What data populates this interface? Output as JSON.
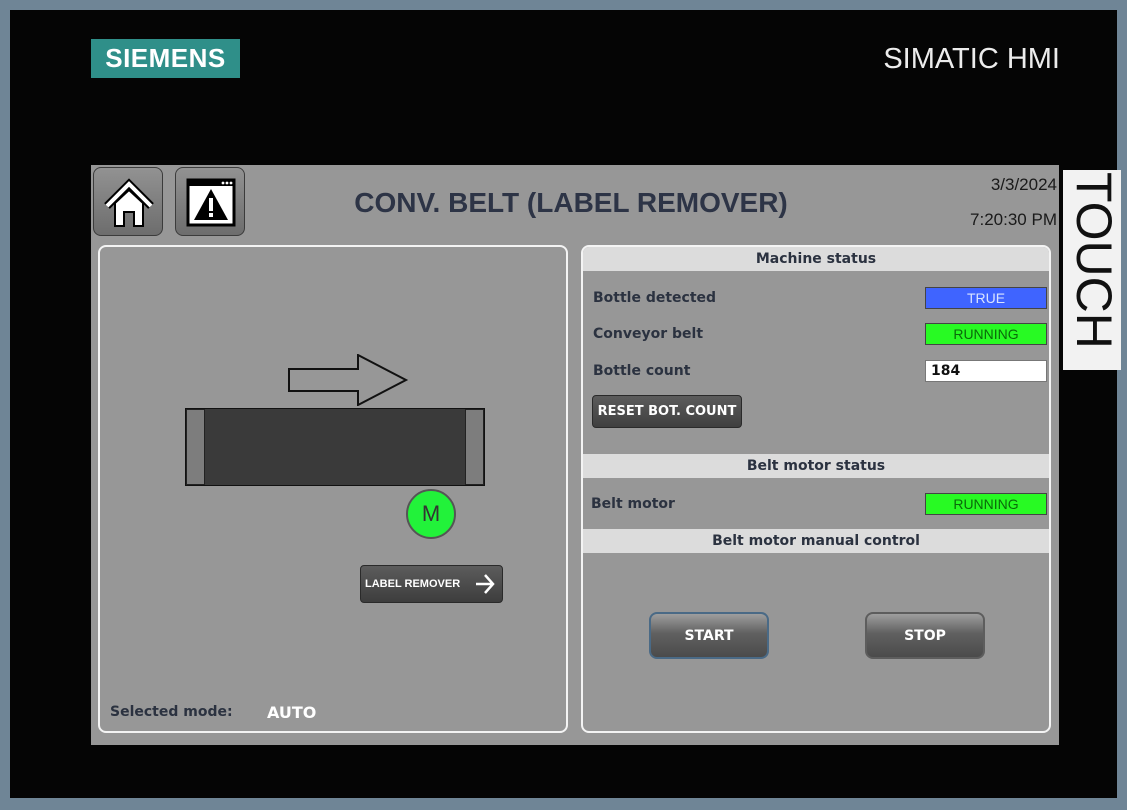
{
  "brand": "SIEMENS",
  "device": "SIMATIC HMI",
  "side_label": "TOUCH",
  "header": {
    "title": "CONV. BELT (LABEL REMOVER)",
    "date": "3/3/2024",
    "time": "7:20:30 PM"
  },
  "left_panel": {
    "motor_label": "M",
    "nav_button": "LABEL REMOVER",
    "selected_mode_label": "Selected mode:",
    "selected_mode_value": "AUTO"
  },
  "machine_status": {
    "title": "Machine status",
    "bottle_detected_label": "Bottle detected",
    "bottle_detected_value": "TRUE",
    "conveyor_belt_label": "Conveyor belt",
    "conveyor_belt_value": "RUNNING",
    "bottle_count_label": "Bottle count",
    "bottle_count_value": "184",
    "reset_button": "RESET BOT. COUNT"
  },
  "belt_motor_status": {
    "title": "Belt motor status",
    "belt_motor_label": "Belt motor",
    "belt_motor_value": "RUNNING"
  },
  "manual_control": {
    "title": "Belt motor manual control",
    "start_button": "START",
    "stop_button": "STOP"
  },
  "colors": {
    "logo_teal": "#2f8f89",
    "status_true": "#3f64ff",
    "status_running": "#28fa23",
    "motor_on": "#22f23a"
  },
  "icons": {
    "home": "home-icon",
    "alarm": "alarm-warning-icon",
    "flow_direction": "right-arrow-icon",
    "nav": "chevron-right-icon"
  }
}
